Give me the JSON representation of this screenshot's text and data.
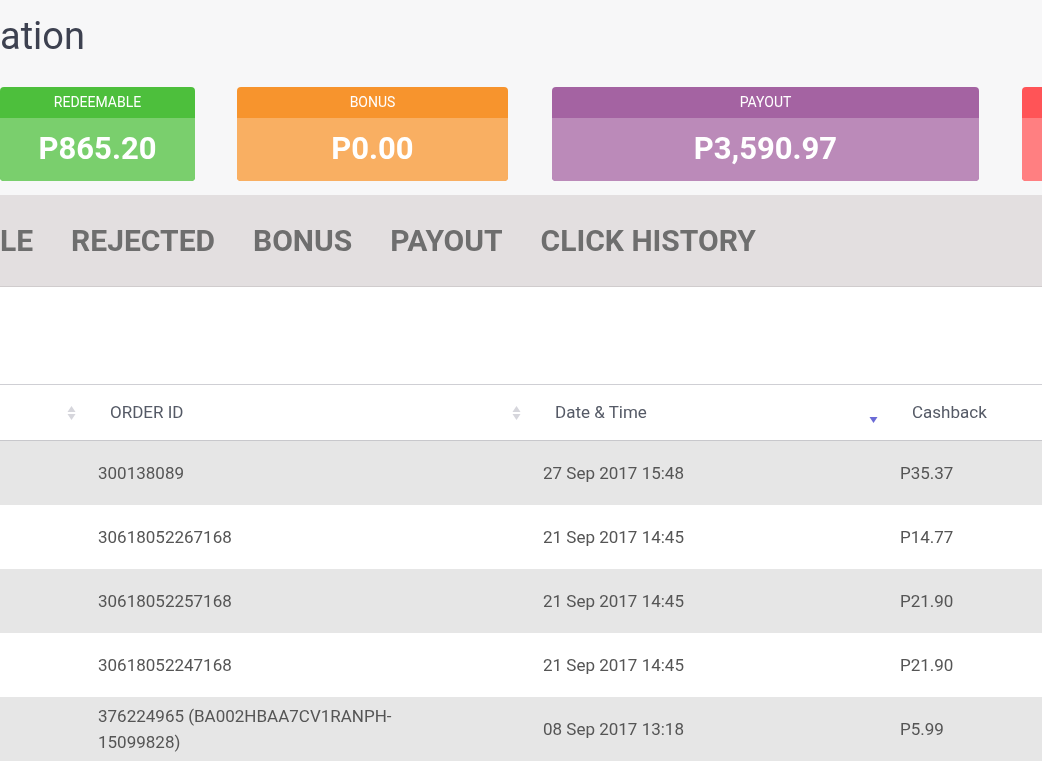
{
  "page_title": "ation",
  "cards": [
    {
      "label": "REDEEMABLE",
      "value": "P865.20",
      "color": "#4dbf3c"
    },
    {
      "label": "BONUS",
      "value": "P0.00",
      "color": "#f7942d"
    },
    {
      "label": "PAYOUT",
      "value": "P3,590.97",
      "color": "#a463a2"
    },
    {
      "color": "#ff5457"
    }
  ],
  "tabs": [
    {
      "label": "LE"
    },
    {
      "label": "REJECTED"
    },
    {
      "label": "BONUS"
    },
    {
      "label": "PAYOUT"
    },
    {
      "label": "CLICK HISTORY"
    }
  ],
  "table": {
    "columns": [
      {
        "sorted": false
      },
      {
        "label": "ORDER ID",
        "sorted": false
      },
      {
        "label": "Date & Time",
        "sorted": true
      },
      {
        "label": "Cashback"
      }
    ],
    "rows": [
      [
        "",
        "300138089",
        "27 Sep 2017 15:48",
        "P35.37"
      ],
      [
        "",
        "30618052267168",
        "21 Sep 2017 14:45",
        "P14.77"
      ],
      [
        "",
        "30618052257168",
        "21 Sep 2017 14:45",
        "P21.90"
      ],
      [
        "",
        "30618052247168",
        "21 Sep 2017 14:45",
        "P21.90"
      ],
      [
        "",
        "376224965 (BA002HBAA7CV1RANPH-15099828)",
        "08 Sep 2017 13:18",
        "P5.99"
      ]
    ]
  }
}
